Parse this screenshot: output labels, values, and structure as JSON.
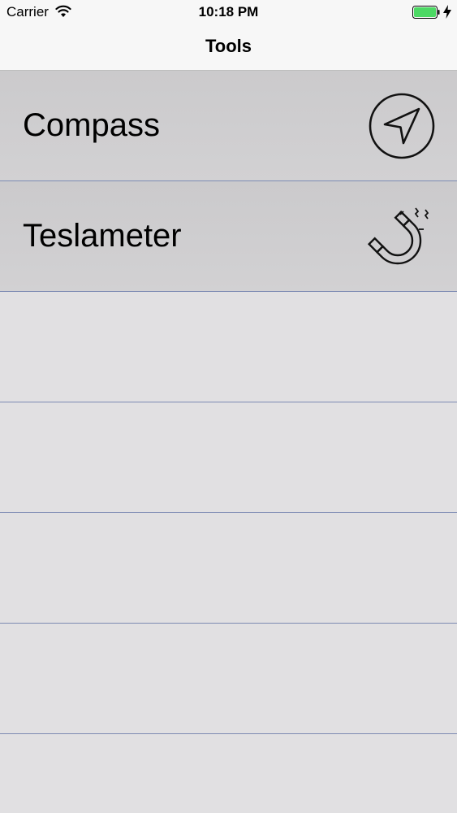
{
  "status_bar": {
    "carrier": "Carrier",
    "time": "10:18 PM",
    "icons": [
      "wifi-icon",
      "battery-icon",
      "charging-icon"
    ],
    "battery_color": "#4cd964"
  },
  "nav": {
    "title": "Tools"
  },
  "list": {
    "items": [
      {
        "label": "Compass",
        "icon": "compass-navigation-icon"
      },
      {
        "label": "Teslameter",
        "icon": "magnet-icon"
      }
    ],
    "empty_rows": 5,
    "separator_color": "#7d8bb3"
  }
}
